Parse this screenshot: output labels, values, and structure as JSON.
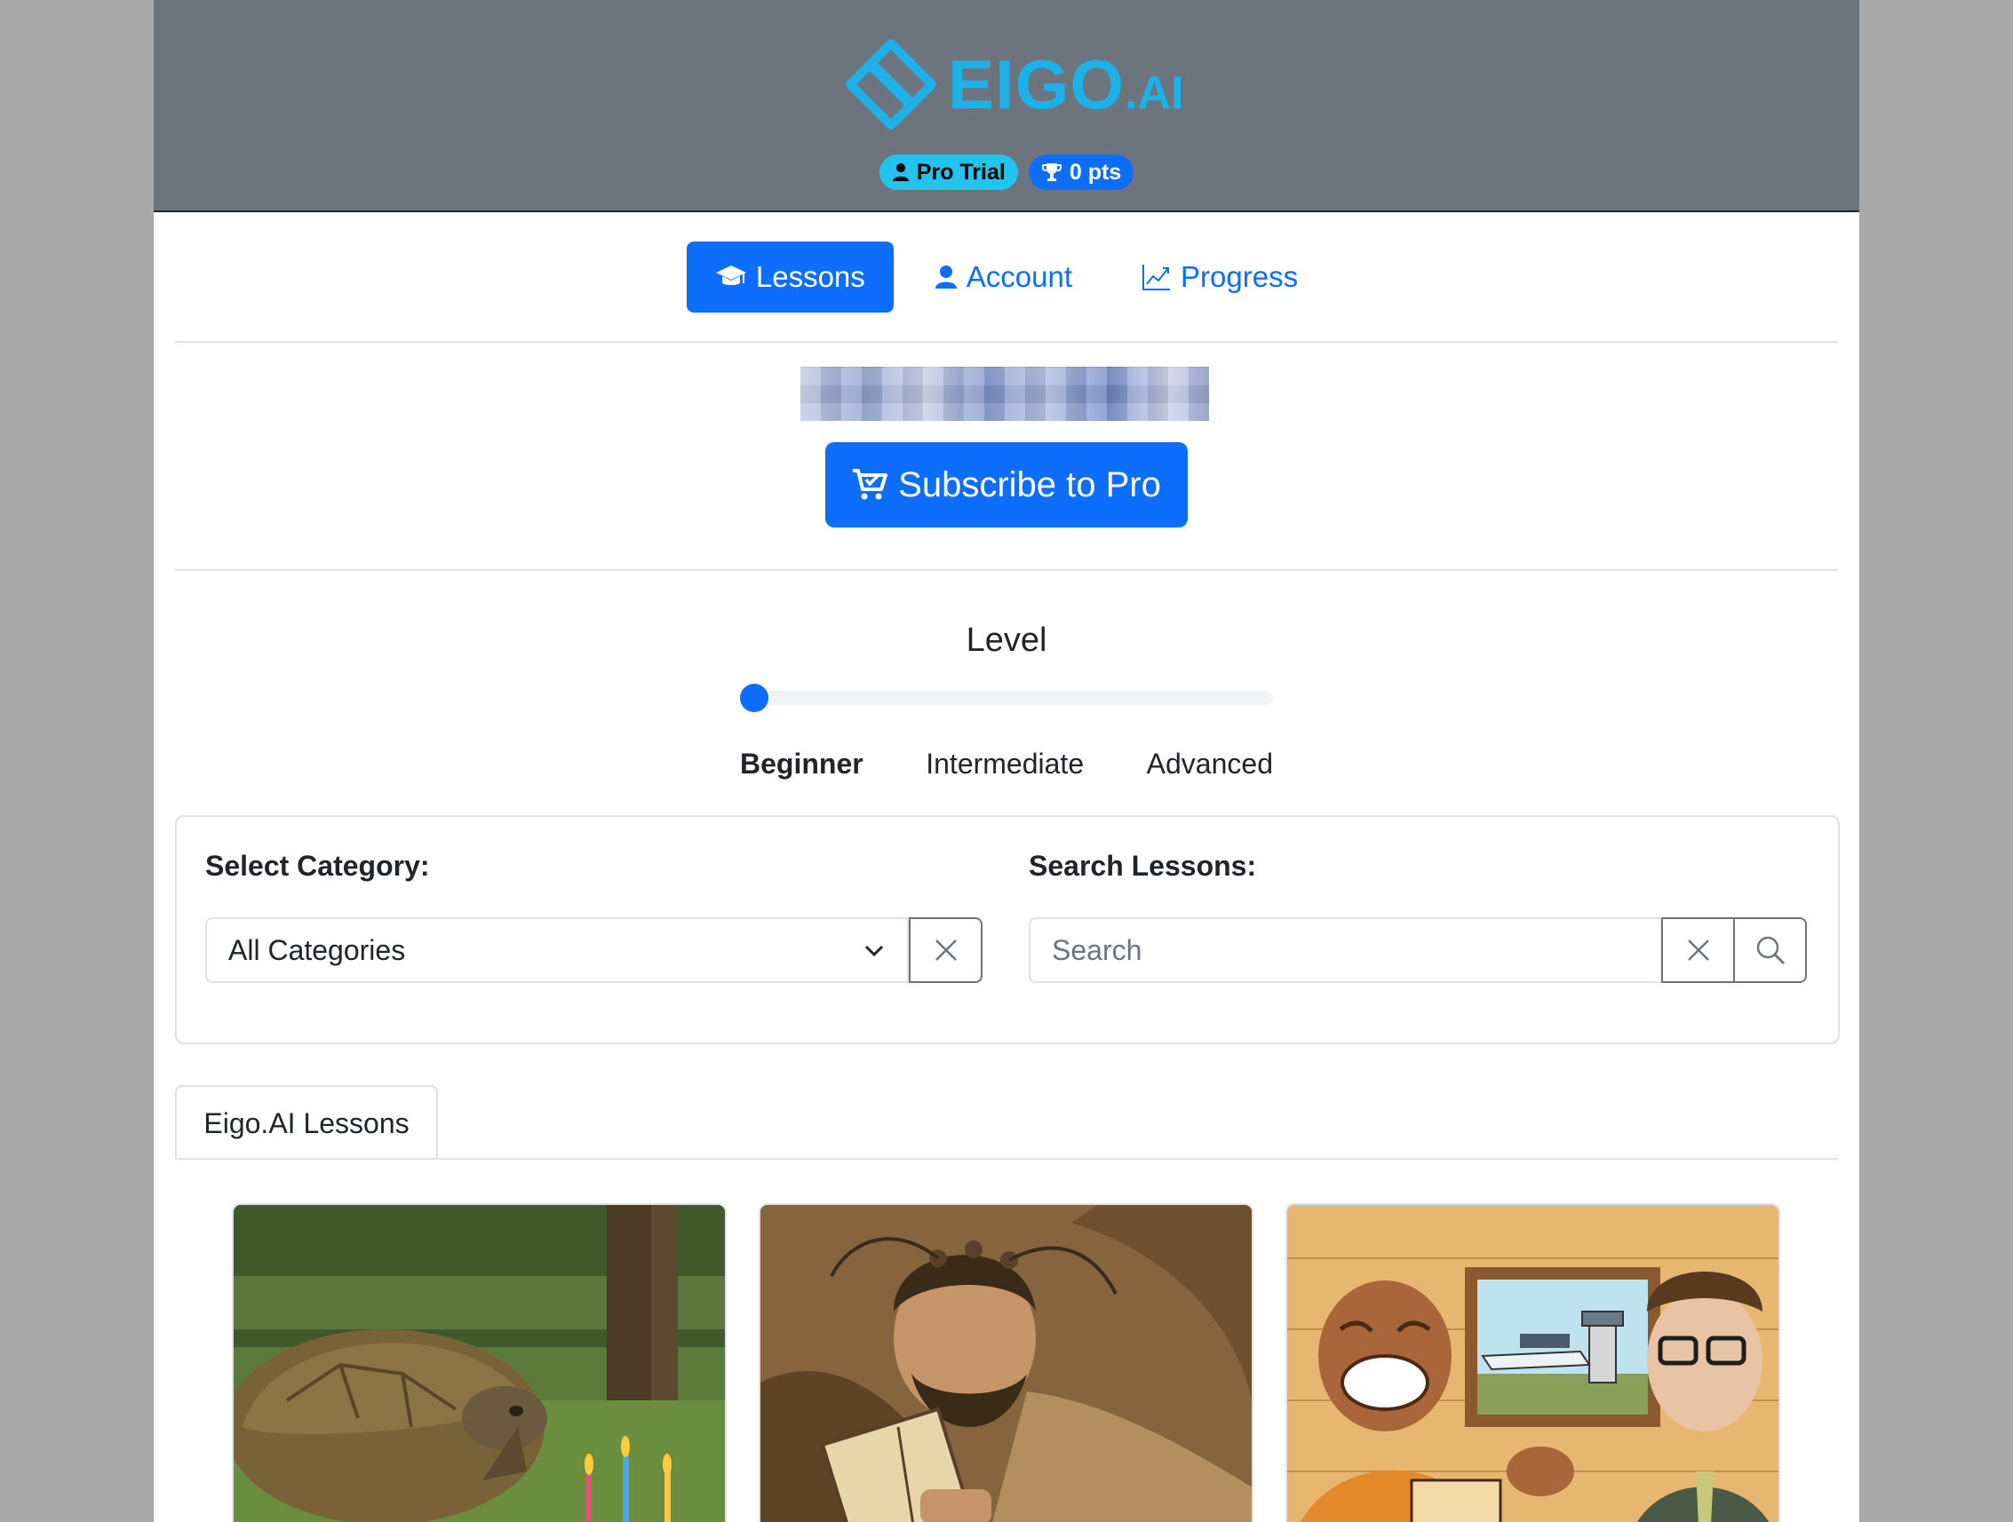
{
  "header": {
    "logo_text_main": "EIGO",
    "logo_text_suffix": ".AI",
    "badge_trial": "Pro Trial",
    "badge_points": "0 pts"
  },
  "nav": {
    "lessons": "Lessons",
    "account": "Account",
    "progress": "Progress"
  },
  "subscribe": {
    "button_label": "Subscribe to Pro"
  },
  "level": {
    "title": "Level",
    "options": [
      "Beginner",
      "Intermediate",
      "Advanced"
    ],
    "selected": "Beginner"
  },
  "filters": {
    "category_label": "Select Category:",
    "category_value": "All Categories",
    "search_label": "Search Lessons:",
    "search_placeholder": "Search"
  },
  "tabs": {
    "active": "Eigo.AI Lessons"
  },
  "lessons": [
    {
      "image": "tortoise-birthday-cake"
    },
    {
      "image": "man-reading-book-with-electrodes"
    },
    {
      "image": "airport-cartoon"
    }
  ],
  "colors": {
    "primary": "#0d6efd",
    "header_bg": "#6c757d",
    "logo": "#1cb1e8",
    "badge_trial": "#22c4ee"
  }
}
